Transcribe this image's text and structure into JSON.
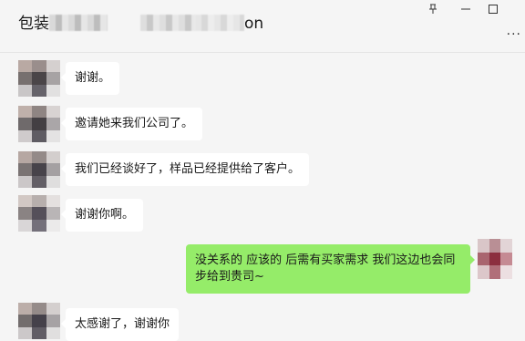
{
  "chat": {
    "title_prefix": "包装",
    "title_suffix": "on"
  },
  "window_controls": {
    "pin": "⊥",
    "minimize": "—",
    "maximize": "□",
    "more": "..."
  },
  "messages": [
    {
      "side": "left",
      "text": "谢谢。"
    },
    {
      "side": "left",
      "text": "邀请她来我们公司了。"
    },
    {
      "side": "left",
      "text": "我们已经谈好了，样品已经提供给了客户。"
    },
    {
      "side": "left",
      "text": "谢谢你啊。"
    },
    {
      "side": "right",
      "text": "没关系的 应该的 后需有买家需求 我们这边也会同步给到贵司~"
    },
    {
      "side": "left",
      "text": "太感谢了，谢谢你"
    }
  ]
}
